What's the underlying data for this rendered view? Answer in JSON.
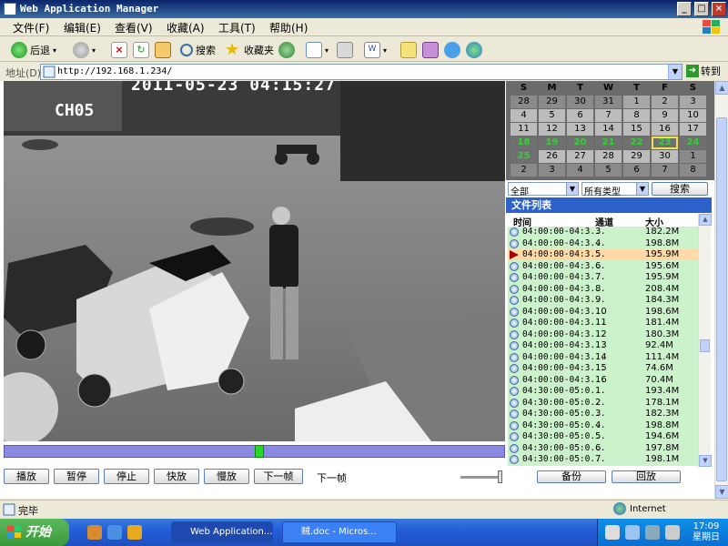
{
  "window": {
    "title": "Web Application Manager"
  },
  "menu": [
    "文件(F)",
    "编辑(E)",
    "查看(V)",
    "收藏(A)",
    "工具(T)",
    "帮助(H)"
  ],
  "toolbar": {
    "back": "后退",
    "search": "搜索",
    "favorites": "收藏夹"
  },
  "address": {
    "label": "地址(D)",
    "url": "http://192.168.1.234/",
    "go": "转到"
  },
  "video": {
    "timestamp": "2011-05-23 04:15:27",
    "channel": "CH05",
    "progress_pct": 51
  },
  "controls": [
    "播放",
    "暂停",
    "停止",
    "快放",
    "慢放",
    "下一帧"
  ],
  "controls_status": "下一帧",
  "calendar": {
    "headers": [
      "S",
      "M",
      "T",
      "W",
      "T",
      "F",
      "S"
    ],
    "weeks": [
      [
        "28",
        "29",
        "30",
        "31",
        "1",
        "2",
        "3"
      ],
      [
        "4",
        "5",
        "6",
        "7",
        "8",
        "9",
        "10"
      ],
      [
        "11",
        "12",
        "13",
        "14",
        "15",
        "16",
        "17"
      ],
      [
        "18",
        "19",
        "20",
        "21",
        "22",
        "23",
        "24"
      ],
      [
        "25",
        "26",
        "27",
        "28",
        "29",
        "30",
        "1"
      ],
      [
        "2",
        "3",
        "4",
        "5",
        "6",
        "7",
        "8"
      ]
    ],
    "selected_day": "23"
  },
  "filters": {
    "scope": "全部",
    "type": "所有类型",
    "search_button": "搜索"
  },
  "file_list": {
    "title": "文件列表",
    "columns": [
      "时间",
      "通道",
      "大小"
    ],
    "rows": [
      {
        "time": "04:00:00-04:3...",
        "channel": "3",
        "size": "182.2M"
      },
      {
        "time": "04:00:00-04:3...",
        "channel": "4",
        "size": "198.8M"
      },
      {
        "time": "04:00:00-04:3...",
        "channel": "5",
        "size": "195.9M",
        "selected": true
      },
      {
        "time": "04:00:00-04:3...",
        "channel": "6",
        "size": "195.6M"
      },
      {
        "time": "04:00:00-04:3...",
        "channel": "7",
        "size": "195.9M"
      },
      {
        "time": "04:00:00-04:3...",
        "channel": "8",
        "size": "208.4M"
      },
      {
        "time": "04:00:00-04:3...",
        "channel": "9",
        "size": "184.3M"
      },
      {
        "time": "04:00:00-04:3...",
        "channel": "10",
        "size": "198.6M"
      },
      {
        "time": "04:00:00-04:3...",
        "channel": "11",
        "size": "181.4M"
      },
      {
        "time": "04:00:00-04:3...",
        "channel": "12",
        "size": "180.3M"
      },
      {
        "time": "04:00:00-04:3...",
        "channel": "13",
        "size": "92.4M"
      },
      {
        "time": "04:00:00-04:3...",
        "channel": "14",
        "size": "111.4M"
      },
      {
        "time": "04:00:00-04:3...",
        "channel": "15",
        "size": "74.6M"
      },
      {
        "time": "04:00:00-04:3...",
        "channel": "16",
        "size": "70.4M"
      },
      {
        "time": "04:30:00-05:0...",
        "channel": "1",
        "size": "193.4M"
      },
      {
        "time": "04:30:00-05:0...",
        "channel": "2",
        "size": "178.1M"
      },
      {
        "time": "04:30:00-05:0...",
        "channel": "3",
        "size": "182.3M"
      },
      {
        "time": "04:30:00-05:0...",
        "channel": "4",
        "size": "198.8M"
      },
      {
        "time": "04:30:00-05:0...",
        "channel": "5",
        "size": "194.6M"
      },
      {
        "time": "04:30:00-05:0...",
        "channel": "6",
        "size": "197.8M"
      },
      {
        "time": "04:30:00-05:0...",
        "channel": "7",
        "size": "198.1M"
      }
    ]
  },
  "panel_buttons": {
    "backup": "备份",
    "playback": "回放"
  },
  "status": {
    "text": "完毕",
    "zone": "Internet"
  },
  "taskbar": {
    "start": "开始",
    "items": [
      "Web Application...",
      "贼.doc - Micros..."
    ],
    "clock_time": "17:09",
    "clock_day": "星期日"
  },
  "colors": {
    "calendar_green": "#35d035",
    "calendar_grey": "#bcbcbc",
    "calendar_dark": "#707070",
    "list_green": "#ccf2cc",
    "list_header": "#2c62c9"
  },
  "icons": [
    "back-arrow-icon",
    "forward-arrow-icon",
    "stop-icon",
    "refresh-icon",
    "home-icon",
    "search-icon",
    "favorites-star-icon",
    "history-icon",
    "mail-icon",
    "print-icon",
    "edit-icon",
    "globe-icon"
  ]
}
